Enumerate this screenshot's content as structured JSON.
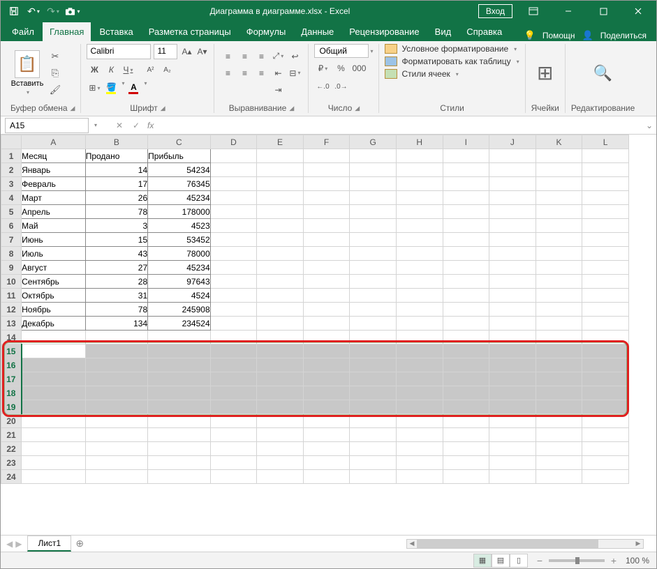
{
  "title": "Диаграмма в диаграмме.xlsx  -  Excel",
  "signin": "Вход",
  "tabs": {
    "file": "Файл",
    "home": "Главная",
    "insert": "Вставка",
    "layout": "Разметка страницы",
    "formulas": "Формулы",
    "data": "Данные",
    "review": "Рецензирование",
    "view": "Вид",
    "help": "Справка",
    "tellme": "Помощн",
    "share": "Поделиться"
  },
  "ribbon": {
    "paste_label": "Вставить",
    "clipboard_group": "Буфер обмена",
    "font_name": "Calibri",
    "font_size": "11",
    "font_group": "Шрифт",
    "align_group": "Выравнивание",
    "number_format": "Общий",
    "number_group": "Число",
    "cond_fmt": "Условное форматирование",
    "fmt_table": "Форматировать как таблицу",
    "cell_styles": "Стили ячеек",
    "styles_group": "Стили",
    "cells_group": "Ячейки",
    "editing_group": "Редактирование"
  },
  "namebox": "A15",
  "columns": [
    "A",
    "B",
    "C",
    "D",
    "E",
    "F",
    "G",
    "H",
    "I",
    "J",
    "K",
    "L"
  ],
  "rows": [
    {
      "n": 1,
      "cells": [
        "Месяц",
        "Продано",
        "Прибыль"
      ],
      "header": true
    },
    {
      "n": 2,
      "cells": [
        "Январь",
        "14",
        "54234"
      ]
    },
    {
      "n": 3,
      "cells": [
        "Февраль",
        "17",
        "76345"
      ]
    },
    {
      "n": 4,
      "cells": [
        "Март",
        "26",
        "45234"
      ]
    },
    {
      "n": 5,
      "cells": [
        "Апрель",
        "78",
        "178000"
      ]
    },
    {
      "n": 6,
      "cells": [
        "Май",
        "3",
        "4523"
      ]
    },
    {
      "n": 7,
      "cells": [
        "Июнь",
        "15",
        "53452"
      ]
    },
    {
      "n": 8,
      "cells": [
        "Июль",
        "43",
        "78000"
      ]
    },
    {
      "n": 9,
      "cells": [
        "Август",
        "27",
        "45234"
      ]
    },
    {
      "n": 10,
      "cells": [
        "Сентябрь",
        "28",
        "97643"
      ]
    },
    {
      "n": 11,
      "cells": [
        "Октябрь",
        "31",
        "4524"
      ]
    },
    {
      "n": 12,
      "cells": [
        "Ноябрь",
        "78",
        "245908"
      ]
    },
    {
      "n": 13,
      "cells": [
        "Декабрь",
        "134",
        "234524"
      ]
    }
  ],
  "empty_rows_before_sel": [
    14
  ],
  "selected_rows": [
    15,
    16,
    17,
    18,
    19
  ],
  "empty_rows_after_sel": [
    20,
    21,
    22,
    23,
    24
  ],
  "sheet_tab": "Лист1",
  "zoom": "100 %"
}
